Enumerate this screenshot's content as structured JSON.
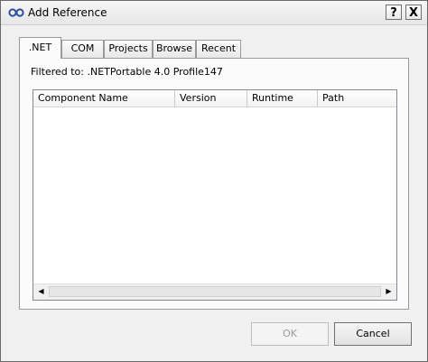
{
  "window": {
    "title": "Add Reference",
    "help_label": "?",
    "close_label": "X"
  },
  "tabs": [
    {
      "label": ".NET",
      "active": true
    },
    {
      "label": "COM",
      "active": false
    },
    {
      "label": "Projects",
      "active": false
    },
    {
      "label": "Browse",
      "active": false
    },
    {
      "label": "Recent",
      "active": false
    }
  ],
  "filter": {
    "text": "Filtered to: .NETPortable 4.0 Profile147"
  },
  "list": {
    "columns": [
      "Component Name",
      "Version",
      "Runtime",
      "Path"
    ],
    "rows": []
  },
  "scrollbar": {
    "left_arrow": "◀",
    "right_arrow": "▶"
  },
  "buttons": {
    "ok_label": "OK",
    "cancel_label": "Cancel"
  }
}
